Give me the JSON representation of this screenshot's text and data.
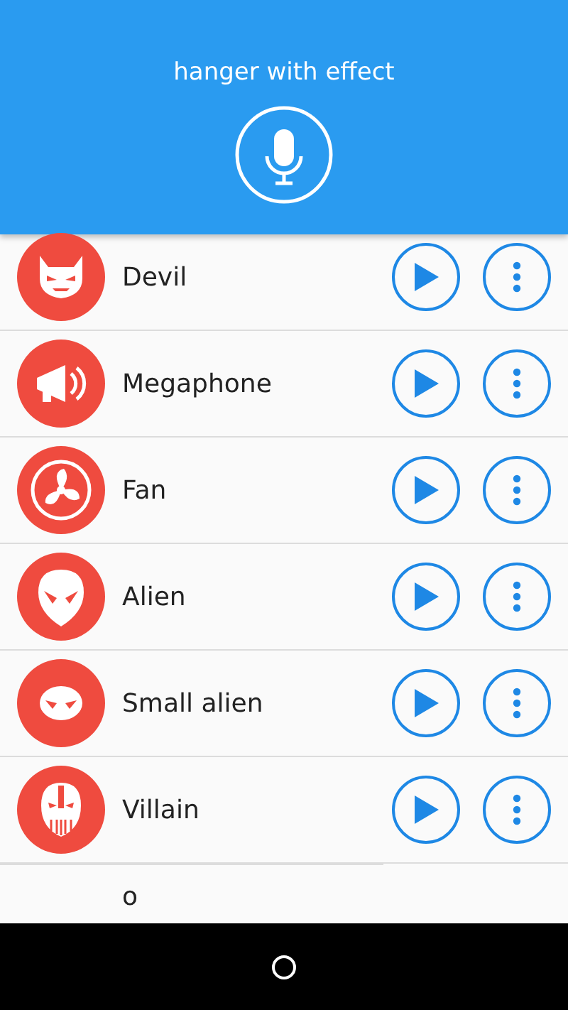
{
  "header": {
    "title": "hanger with effect"
  },
  "effects": [
    {
      "kind": "devil",
      "name": "Devil"
    },
    {
      "kind": "megaphone",
      "name": "Megaphone"
    },
    {
      "kind": "fan",
      "name": "Fan"
    },
    {
      "kind": "alien",
      "name": "Alien"
    },
    {
      "kind": "small-alien",
      "name": "Small alien"
    },
    {
      "kind": "villain",
      "name": "Villain"
    },
    {
      "kind": "partial",
      "name": "o"
    }
  ]
}
